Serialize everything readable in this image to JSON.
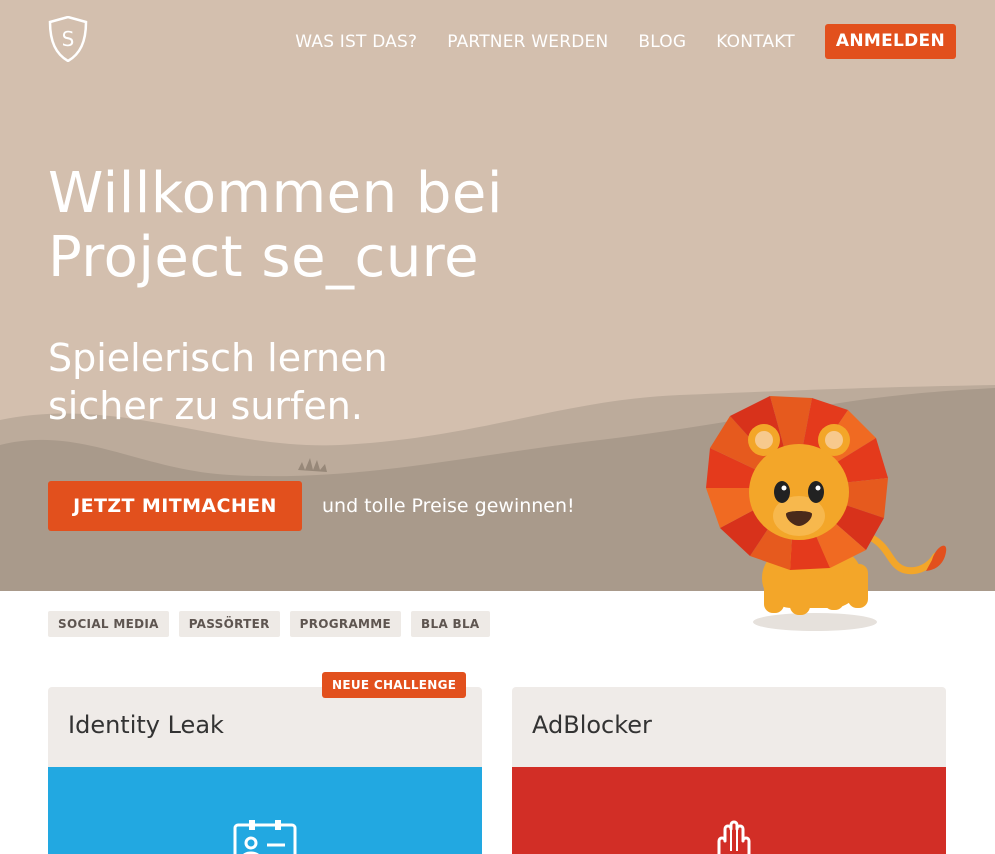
{
  "header": {
    "logo_letter": "S",
    "nav": [
      {
        "label": "WAS IST DAS?"
      },
      {
        "label": "PARTNER WERDEN"
      },
      {
        "label": "BLOG"
      },
      {
        "label": "KONTAKT"
      }
    ],
    "login_label": "ANMELDEN"
  },
  "hero": {
    "title_line1": "Willkommen bei",
    "title_line2": "Project se_cure",
    "subtitle_line1": "Spielerisch lernen",
    "subtitle_line2": "sicher zu surfen.",
    "cta_label": "JETZT MITMACHEN",
    "cta_note": "und tolle Preise gewinnen!"
  },
  "tags": [
    "SOCIAL MEDIA",
    "PASSÖRTER",
    "PROGRAMME",
    "BLA BLA"
  ],
  "cards": [
    {
      "title": "Identity Leak",
      "badge": "NEUE CHALLENGE",
      "icon": "id-card-icon",
      "color": "#22a8e1"
    },
    {
      "title": "AdBlocker",
      "icon": "hand-stop-icon",
      "color": "#d22e26"
    }
  ],
  "colors": {
    "accent": "#e2501d",
    "hero_bg": "#d3bfae",
    "hill": "#a8998a",
    "card_blue": "#22a8e1",
    "card_red": "#d22e26"
  }
}
